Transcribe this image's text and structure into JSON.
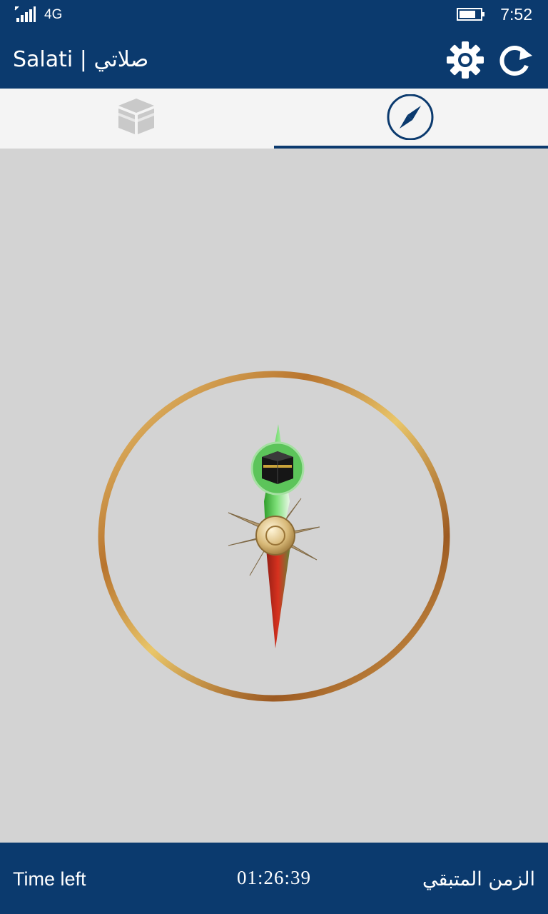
{
  "status_bar": {
    "network": "4G",
    "time": "7:52",
    "signal_icon": "signal-bars-icon",
    "battery_icon": "battery-icon"
  },
  "app_bar": {
    "title": "Salati | صلاتي",
    "settings_icon": "gear-icon",
    "refresh_icon": "refresh-icon"
  },
  "tabs": [
    {
      "name": "kaaba-tab",
      "icon": "kaaba-icon",
      "selected": false
    },
    {
      "name": "compass-tab",
      "icon": "compass-icon",
      "selected": true
    }
  ],
  "compass": {
    "qibla_icon": "kaaba-icon",
    "colors": {
      "ring": "#b8742e",
      "needle_north": "#4fc04a",
      "needle_south": "#c8281c"
    }
  },
  "footer": {
    "left_label": "Time left",
    "countdown": "01:26:39",
    "right_label": "الزمن المتبقي"
  },
  "colors": {
    "primary": "#0b3a6e",
    "tab_bg": "#f4f4f4",
    "content_bg": "#d3d3d3"
  }
}
